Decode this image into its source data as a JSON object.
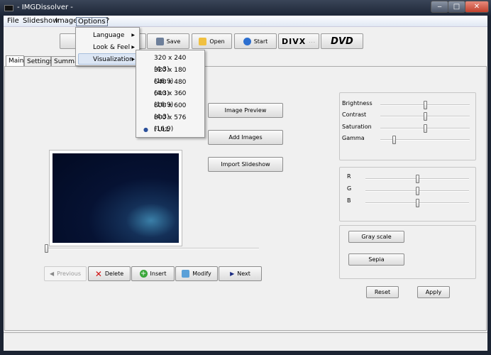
{
  "window": {
    "title": "- IMGDissolver -",
    "minimize": "‒",
    "maximize": "□",
    "close": "✕"
  },
  "menubar": {
    "items": [
      "File",
      "Slideshow",
      "Image",
      "Options",
      "?"
    ]
  },
  "options_menu": {
    "items": [
      {
        "label": "Language"
      },
      {
        "label": "Look & Feel"
      },
      {
        "label": "Visualization",
        "highlighted": true
      }
    ]
  },
  "visualization_submenu": {
    "items": [
      "320 x 240 (4:3)",
      "320 x 180 (16:9)",
      "640 x 480 (4:3)",
      "640 x 360 (16:9)",
      "800 x 600 (4:3)",
      "800 x 576 (16:9)",
      "FULL"
    ],
    "selected": "FULL"
  },
  "toolbar": {
    "save": "Save",
    "open": "Open",
    "start": "Start",
    "divx": "DIVX",
    "divx_more": "...",
    "dvd": "DVD"
  },
  "tabs": [
    "Main",
    "Settings",
    "Summary"
  ],
  "actions": {
    "image_preview": "Image Preview",
    "add_images": "Add Images",
    "import_slideshow": "Import Slideshow"
  },
  "adjust": {
    "brightness": {
      "label": "Brightness",
      "value": 0.5
    },
    "contrast": {
      "label": "Contrast",
      "value": 0.5
    },
    "saturation": {
      "label": "Saturation",
      "value": 0.5
    },
    "gamma": {
      "label": "Gamma",
      "value": 0.14
    }
  },
  "rgb": {
    "r": {
      "label": "R",
      "value": 0.5
    },
    "g": {
      "label": "G",
      "value": 0.5
    },
    "b": {
      "label": "B",
      "value": 0.5
    }
  },
  "filters": {
    "gray": "Gray scale",
    "sepia": "Sepia"
  },
  "reset": "Reset",
  "apply": "Apply",
  "position_slider": {
    "value": 0
  },
  "nav": {
    "previous": "Previous",
    "delete": "Delete",
    "insert": "Insert",
    "modify": "Modify",
    "next": "Next"
  }
}
